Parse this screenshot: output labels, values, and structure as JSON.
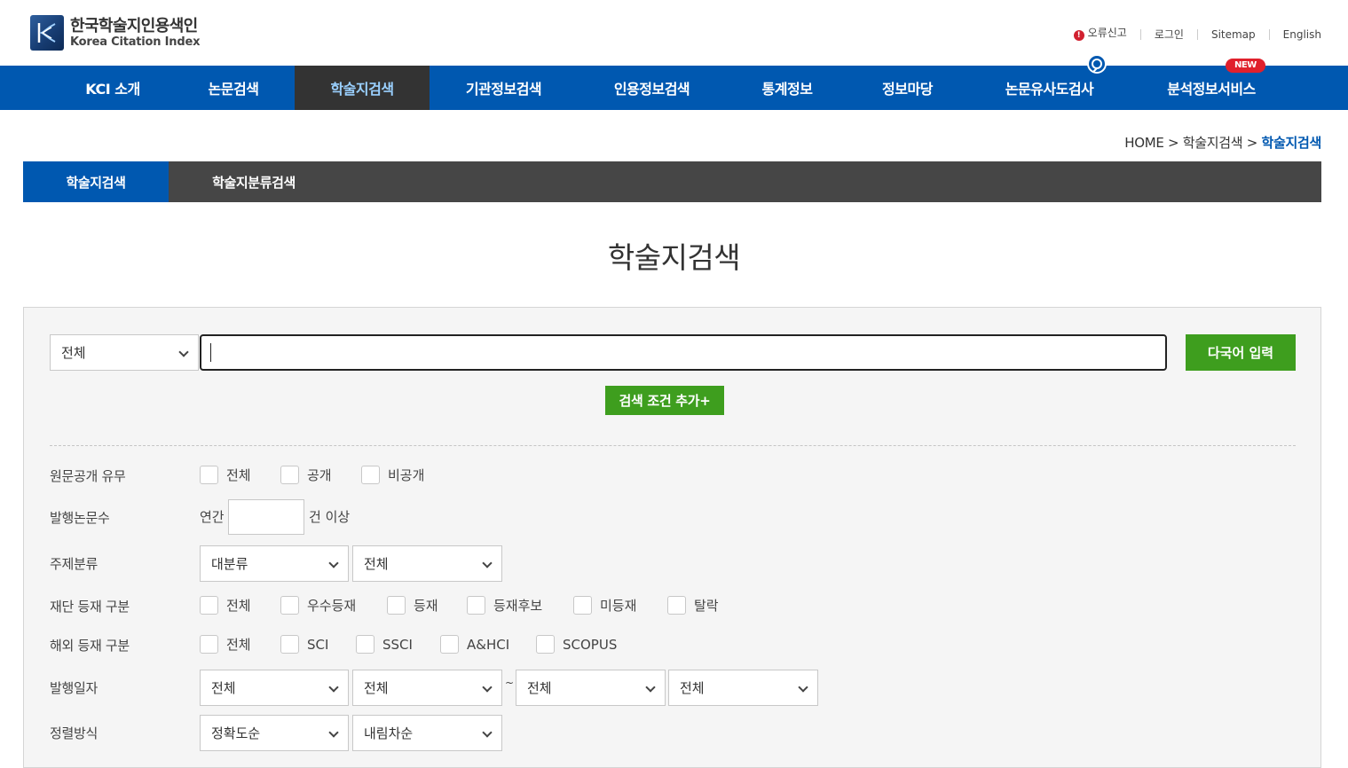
{
  "header": {
    "logo_ko": "한국학술지인용색인",
    "logo_en": "Korea Citation Index",
    "util_links": [
      "오류신고",
      "로그인",
      "Sitemap",
      "English"
    ]
  },
  "nav": {
    "items": [
      "KCI 소개",
      "논문검색",
      "학술지검색",
      "기관정보검색",
      "인용정보검색",
      "통계정보",
      "정보마당",
      "논문유사도검사",
      "분석정보서비스"
    ],
    "new_badge": "NEW",
    "active": "학술지검색"
  },
  "breadcrumb": {
    "home": "HOME",
    "sep": ">",
    "parent": "학술지검색",
    "current": "학술지검색"
  },
  "subtabs": [
    "학술지검색",
    "학술지분류검색"
  ],
  "page_title": "학술지검색",
  "search": {
    "field_select": "전체",
    "keyword": "",
    "multilang_button": "다국어 입력",
    "add_condition_button": "검색 조건 추가+"
  },
  "filters": {
    "fulltext": {
      "label": "원문공개 유무",
      "options": [
        "전체",
        "공개",
        "비공개"
      ]
    },
    "count": {
      "label": "발행논문수",
      "prefix": "연간",
      "suffix": "건 이상",
      "value": ""
    },
    "subject": {
      "label": "주제분류",
      "select1": "대분류",
      "select2": "전체"
    },
    "foundation": {
      "label": "재단 등재 구분",
      "options": [
        "전체",
        "우수등재",
        "등재",
        "등재후보",
        "미등재",
        "탈락"
      ]
    },
    "overseas": {
      "label": "해외 등재 구분",
      "options": [
        "전체",
        "SCI",
        "SSCI",
        "A&HCI",
        "SCOPUS"
      ]
    },
    "pubdate": {
      "label": "발행일자",
      "selects": [
        "전체",
        "전체",
        "전체",
        "전체"
      ],
      "tilde": "~"
    },
    "sort": {
      "label": "정렬방식",
      "select1": "정확도순",
      "select2": "내림차순"
    }
  },
  "colors": {
    "nav_blue": "#0058b0",
    "active_dark": "#333333",
    "green": "#3e9e1e",
    "alert_red": "#d1202f"
  }
}
